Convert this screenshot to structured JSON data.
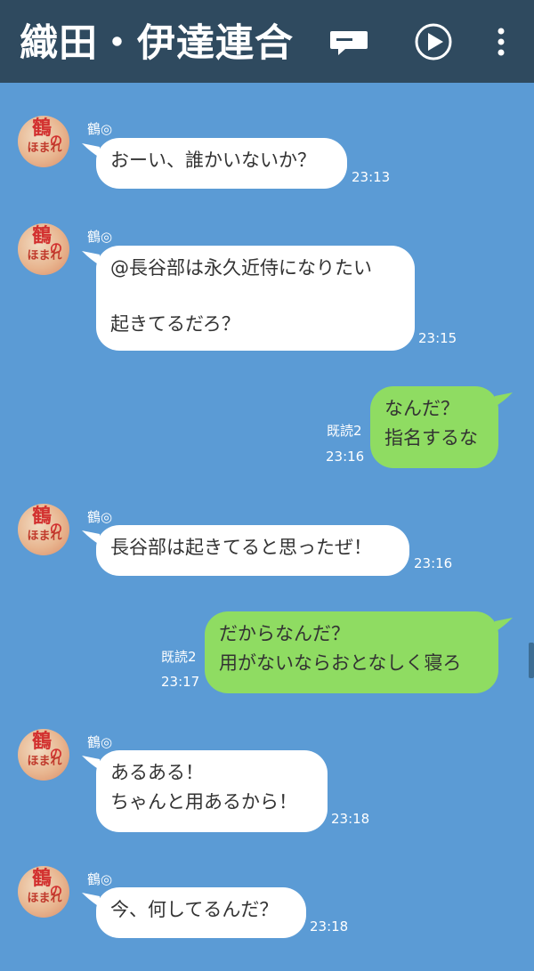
{
  "header": {
    "title": "織田・伊達連合",
    "icons": [
      "note-icon",
      "play-icon",
      "more-vertical-icon"
    ]
  },
  "avatar": {
    "kanji": "鶴",
    "no": "の",
    "sub": "ほまれ"
  },
  "messages": [
    {
      "sender": "鶴◎",
      "lines": [
        "おーい、誰かいないか？"
      ],
      "time": "23:13"
    },
    {
      "sender": "鶴◎",
      "lines": [
        "@長谷部は永久近侍になりたい",
        "",
        "起きてるだろ？"
      ],
      "time": "23:15"
    },
    {
      "lines": [
        "なんだ？",
        "指名するな"
      ],
      "read": "既読2",
      "time": "23:16"
    },
    {
      "sender": "鶴◎",
      "lines": [
        "長谷部は起きてると思ったぜ！"
      ],
      "time": "23:16"
    },
    {
      "lines": [
        "だからなんだ？",
        "用がないならおとなしく寝ろ"
      ],
      "read": "既読2",
      "time": "23:17"
    },
    {
      "sender": "鶴◎",
      "lines": [
        "あるある！",
        "ちゃんと用あるから！"
      ],
      "time": "23:18"
    },
    {
      "sender": "鶴◎",
      "lines": [
        "今、何してるんだ？"
      ],
      "time": "23:18"
    }
  ],
  "colors": {
    "background": "#5b9bd5",
    "header": "#2f4a5f",
    "incoming_bubble": "#ffffff",
    "outgoing_bubble": "#8fdc62"
  }
}
